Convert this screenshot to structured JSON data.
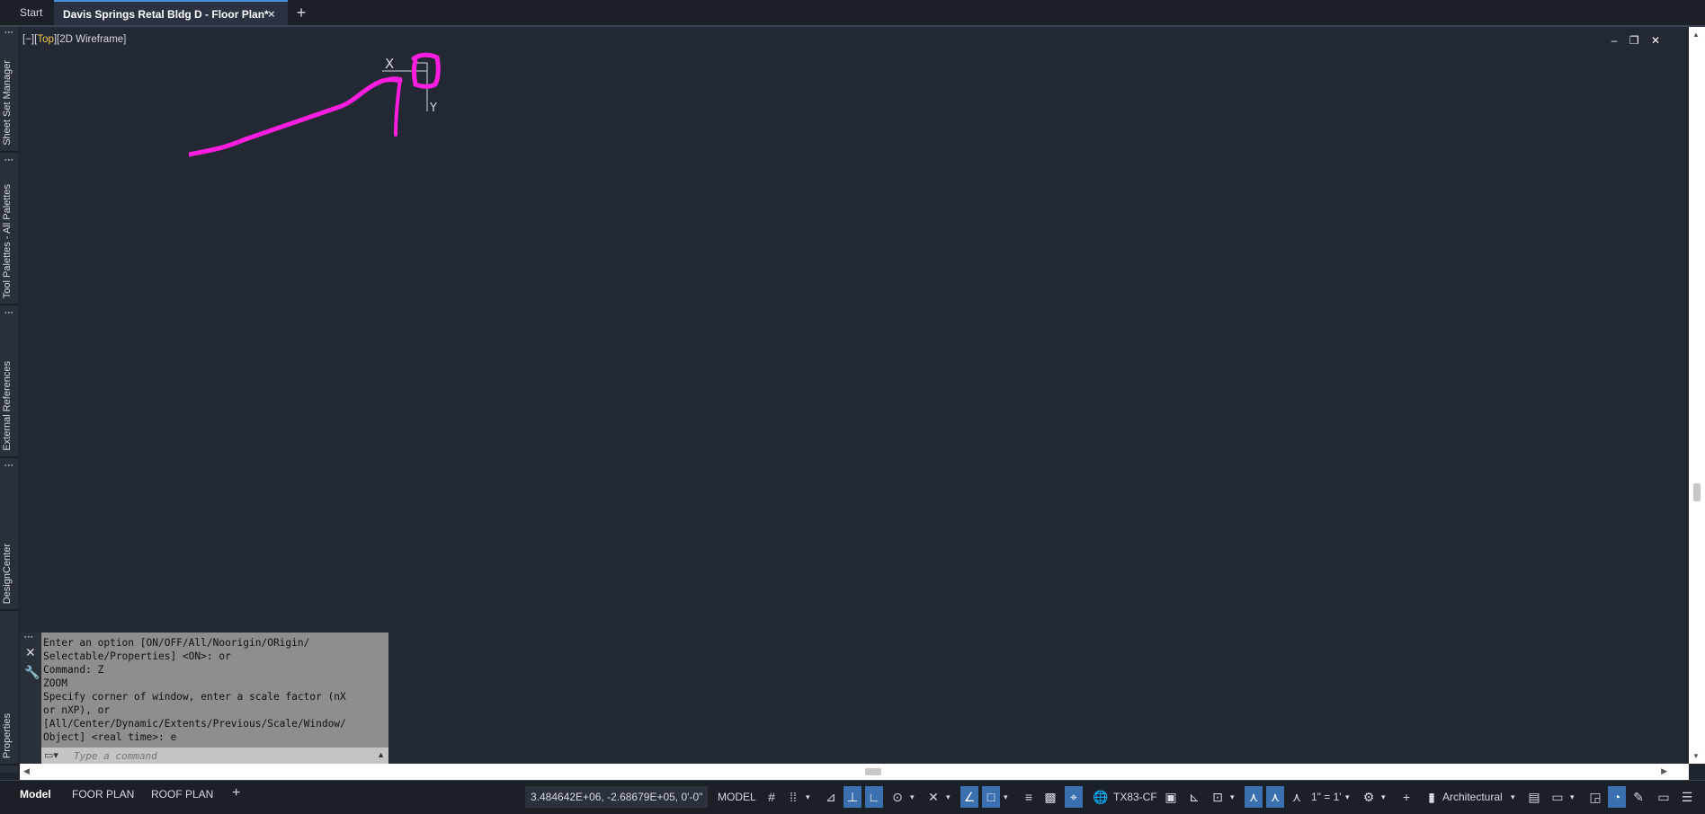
{
  "tabs": {
    "start": "Start",
    "active": "Davis Springs Retal  Bldg D - Floor Plan*",
    "close": "×",
    "add": "+"
  },
  "palettes": [
    "Sheet Set Manager",
    "Tool Palettes - All Palettes",
    "External References",
    "DesignCenter",
    "Properties"
  ],
  "viewport": {
    "label_prefix": "[−][",
    "view": "Top",
    "label_suffix": "][2D Wireframe]",
    "min": "–",
    "restore": "❐",
    "close": "✕",
    "ucs_x": "X",
    "ucs_y": "Y"
  },
  "command_line": {
    "history": [
      "Enter an option [ON/OFF/All/Noorigin/ORigin/",
      "Selectable/Properties] <ON>: or",
      "Command: Z",
      "ZOOM",
      "Specify corner of window, enter a scale factor (nX",
      "or nXP), or",
      "[All/Center/Dynamic/Extents/Previous/Scale/Window/",
      "Object] <real time>: e"
    ],
    "placeholder": "Type a command"
  },
  "layout_tabs": [
    "Model",
    "FOOR PLAN",
    "ROOF PLAN",
    "+"
  ],
  "status": {
    "coords": "3.484642E+06, -2.68679E+05, 0'-0\"",
    "space": "MODEL",
    "coord_system": "TX83-CF",
    "scale": "1\" = 1'",
    "units": "Architectural"
  },
  "icons": {
    "grid": "grid-icon",
    "snap": "snap-icon",
    "ortho": "ortho-icon",
    "polar": "polar-icon",
    "osnap": "osnap-icon",
    "settings": "gear-icon"
  },
  "colors": {
    "annotation": "#ff1de0",
    "background": "#222834",
    "accent": "#3a70b0"
  }
}
